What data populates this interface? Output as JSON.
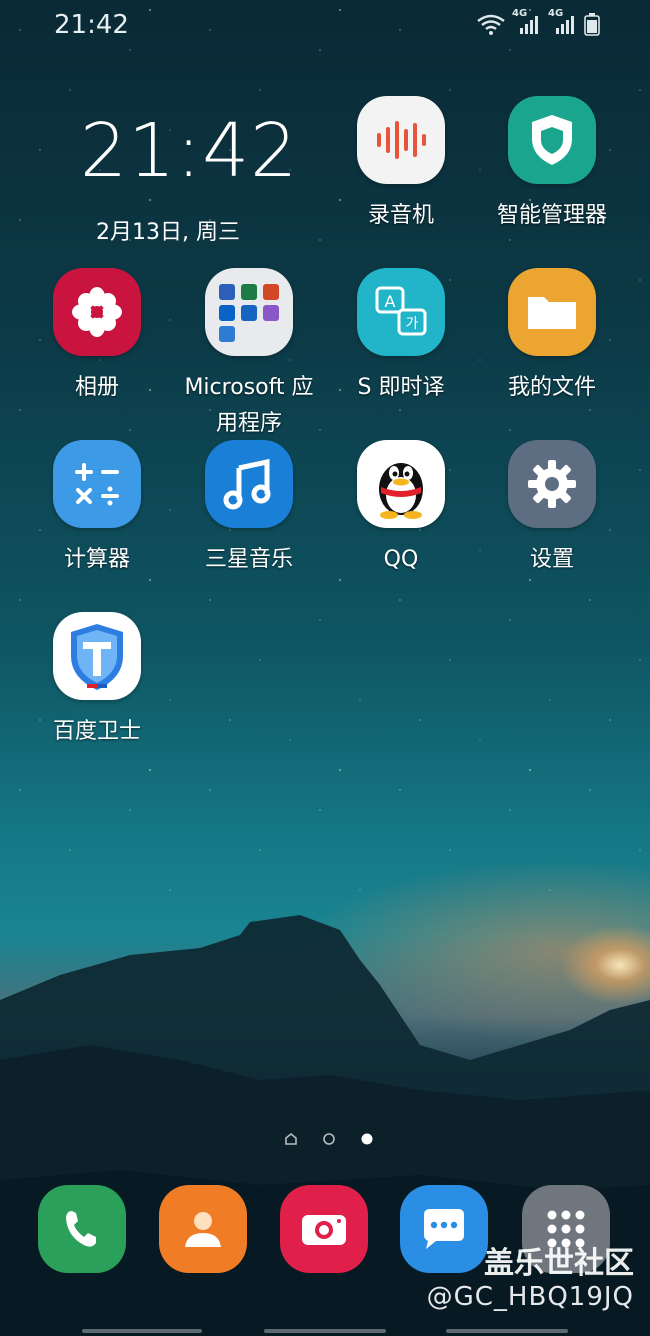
{
  "status_bar": {
    "time": "21:42",
    "network_labels": [
      "4G",
      "4G"
    ]
  },
  "clock_widget": {
    "time": "21:42",
    "date": "2月13日, 周三"
  },
  "apps": [
    {
      "label": "录音机",
      "icon": "voice-recorder-icon",
      "color": "#f3f3f3"
    },
    {
      "label": "智能管理器",
      "icon": "shield-icon",
      "color": "#1aa58f"
    },
    {
      "label": "相册",
      "icon": "flower-icon",
      "color": "#c8143e"
    },
    {
      "label": "Microsoft 应用程序",
      "icon": "folder-grid-icon",
      "color": "#e8eaee"
    },
    {
      "label": "S 即时译",
      "icon": "translate-icon",
      "color": "#22b5c9"
    },
    {
      "label": "我的文件",
      "icon": "folder-icon",
      "color": "#eca530"
    },
    {
      "label": "计算器",
      "icon": "calculator-icon",
      "color": "#3d9ae6"
    },
    {
      "label": "三星音乐",
      "icon": "music-note-icon",
      "color": "#1a7fd6"
    },
    {
      "label": "QQ",
      "icon": "penguin-icon",
      "color": "#ffffff"
    },
    {
      "label": "设置",
      "icon": "gear-icon",
      "color": "#5e6e82"
    },
    {
      "label": "百度卫士",
      "icon": "baidu-shield-icon",
      "color": "#ffffff"
    }
  ],
  "page_indicator": {
    "pages": 3,
    "current": 3
  },
  "dock": [
    {
      "icon": "phone-icon",
      "color": "#2aa05a"
    },
    {
      "icon": "contacts-icon",
      "color": "#f07c26"
    },
    {
      "icon": "camera-icon",
      "color": "#e0204a"
    },
    {
      "icon": "messages-icon",
      "color": "#2a8ee4"
    },
    {
      "icon": "app-drawer-icon",
      "color": "#6f767e"
    }
  ],
  "watermark": {
    "title": "盖乐世社区",
    "handle": "@GC_HBQ19JQ"
  }
}
